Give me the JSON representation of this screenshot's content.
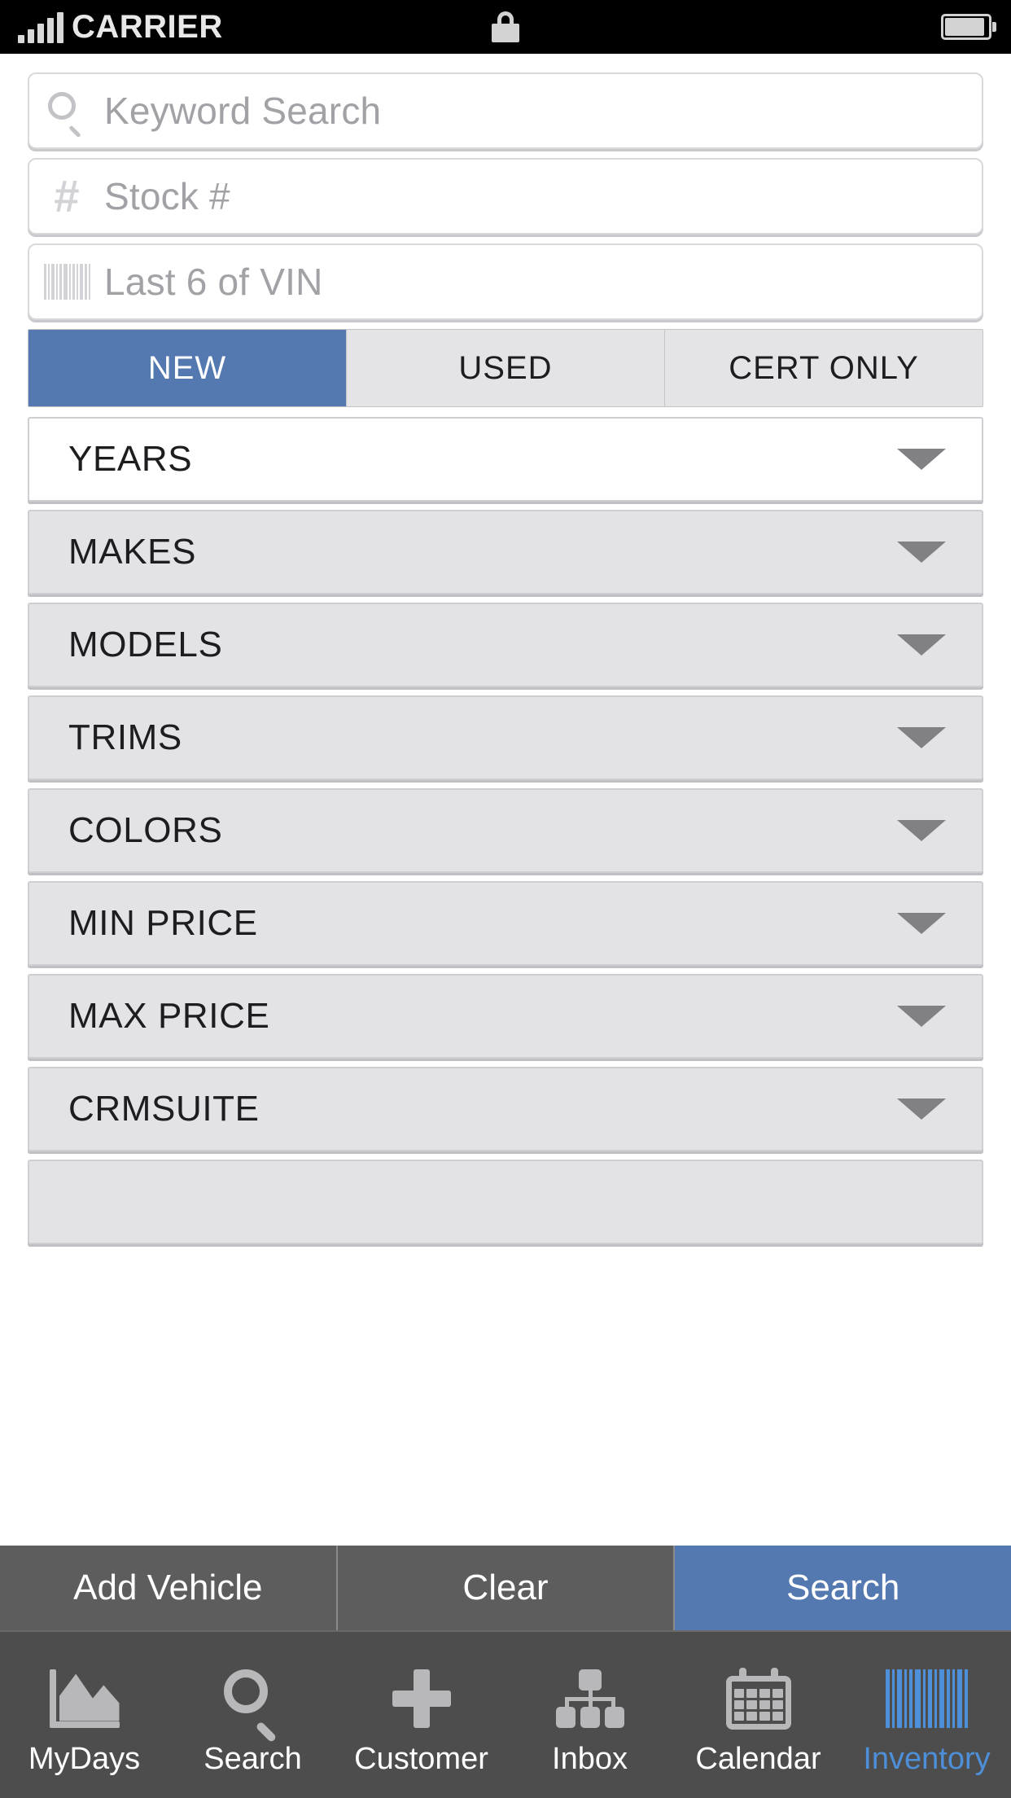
{
  "status_bar": {
    "carrier": "CARRIER",
    "signal_icon": "signal-bars-icon",
    "lock_icon": "lock-icon",
    "battery_icon": "battery-icon"
  },
  "search_fields": [
    {
      "placeholder": "Keyword Search",
      "icon": "search-icon",
      "value": ""
    },
    {
      "placeholder": "Stock #",
      "icon": "hash-icon",
      "value": ""
    },
    {
      "placeholder": "Last 6 of VIN",
      "icon": "barcode-icon",
      "value": ""
    }
  ],
  "condition_tabs": [
    {
      "label": "NEW",
      "active": true
    },
    {
      "label": "USED",
      "active": false
    },
    {
      "label": "CERT ONLY",
      "active": false
    }
  ],
  "filters": [
    {
      "label": "YEARS",
      "style": "white"
    },
    {
      "label": "MAKES",
      "style": "gray"
    },
    {
      "label": "MODELS",
      "style": "gray"
    },
    {
      "label": "TRIMS",
      "style": "gray"
    },
    {
      "label": "COLORS",
      "style": "gray"
    },
    {
      "label": "MIN PRICE",
      "style": "gray"
    },
    {
      "label": "MAX PRICE",
      "style": "gray"
    },
    {
      "label": "CRMSUITE",
      "style": "gray"
    },
    {
      "label": "",
      "style": "gray"
    }
  ],
  "action_bar": {
    "add_vehicle": "Add Vehicle",
    "clear": "Clear",
    "search": "Search"
  },
  "tab_bar": [
    {
      "label": "MyDays",
      "icon": "chart-icon",
      "active": false
    },
    {
      "label": "Search",
      "icon": "search-icon",
      "active": false
    },
    {
      "label": "Customer",
      "icon": "plus-icon",
      "active": false
    },
    {
      "label": "Inbox",
      "icon": "org-chart-icon",
      "active": false
    },
    {
      "label": "Calendar",
      "icon": "calendar-icon",
      "active": false
    },
    {
      "label": "Inventory",
      "icon": "barcode-icon",
      "active": true
    }
  ],
  "colors": {
    "accent_blue": "#5478b0",
    "tab_active_blue": "#4d90d9",
    "row_gray": "#e3e3e6",
    "action_gray": "#5d5d5d",
    "tabbar_gray": "#4d4d4d",
    "placeholder_gray": "#a2a2a6"
  }
}
